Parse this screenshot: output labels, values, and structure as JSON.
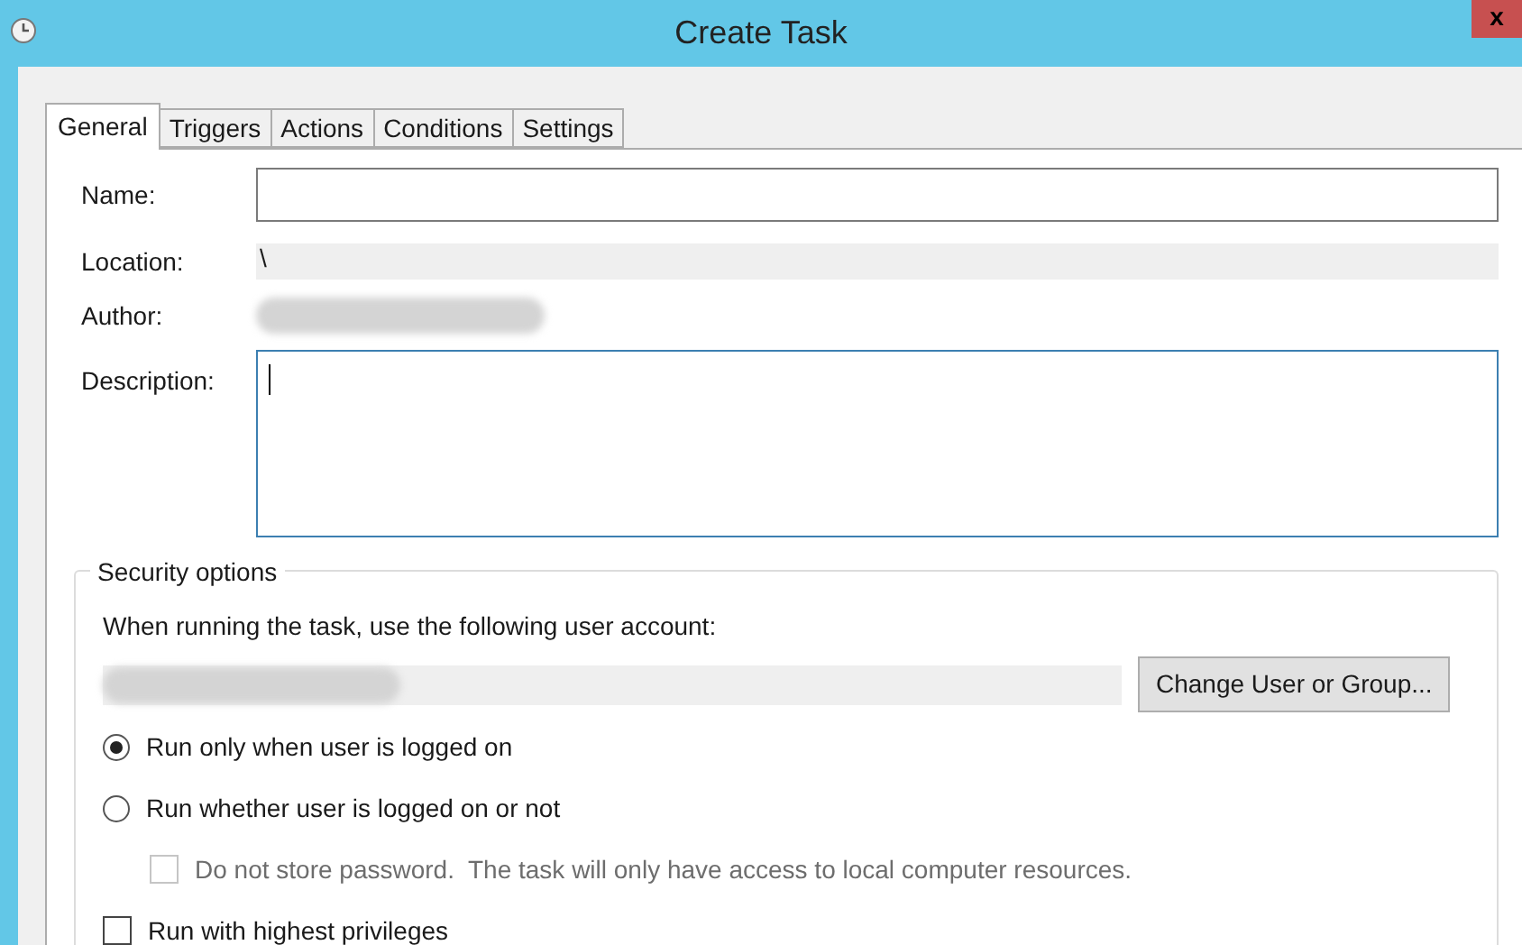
{
  "window": {
    "title": "Create Task",
    "close": "x"
  },
  "tabs": [
    {
      "label": "General",
      "selected": true
    },
    {
      "label": "Triggers",
      "selected": false
    },
    {
      "label": "Actions",
      "selected": false
    },
    {
      "label": "Conditions",
      "selected": false
    },
    {
      "label": "Settings",
      "selected": false
    }
  ],
  "general": {
    "name": {
      "label": "Name:"
    },
    "location": {
      "label": "Location:",
      "value": "\\"
    },
    "author": {
      "label": "Author:"
    },
    "description": {
      "label": "Description:",
      "focused": true
    }
  },
  "security": {
    "title": "Security options",
    "account_label": "When running the task, use the following user account:",
    "change_button": "Change User or Group...",
    "options": [
      {
        "kind": "radio",
        "label": "Run only when user is logged on",
        "selected": true,
        "disabled": false,
        "nested": false
      },
      {
        "kind": "radio",
        "label": "Run whether user is logged on or not",
        "selected": false,
        "disabled": false,
        "nested": false
      },
      {
        "kind": "checkbox",
        "label": "Do not store password.  The task will only have access to local computer resources.",
        "checked": false,
        "disabled": true,
        "nested": true
      },
      {
        "kind": "checkbox",
        "label": "Run with highest privileges",
        "checked": false,
        "disabled": false,
        "nested": false
      }
    ]
  }
}
